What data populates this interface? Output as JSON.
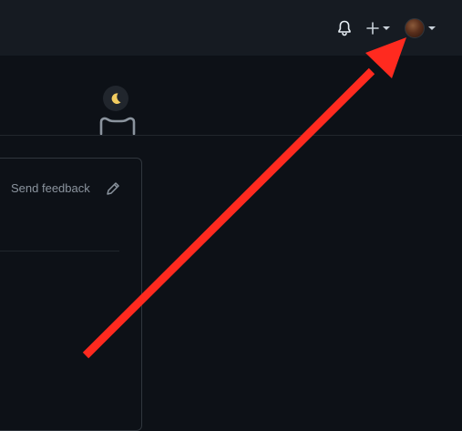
{
  "header": {
    "notifications_icon": "bell-icon",
    "create_icon": "plus-icon",
    "avatar_icon": "user-avatar"
  },
  "panel": {
    "feedback_label": "Send feedback",
    "edit_icon": "pencil-icon"
  },
  "theme": {
    "background": "#0d1117",
    "header_bg": "#161b22",
    "border": "#30363d",
    "annotation_arrow": "#ff2a1f"
  }
}
